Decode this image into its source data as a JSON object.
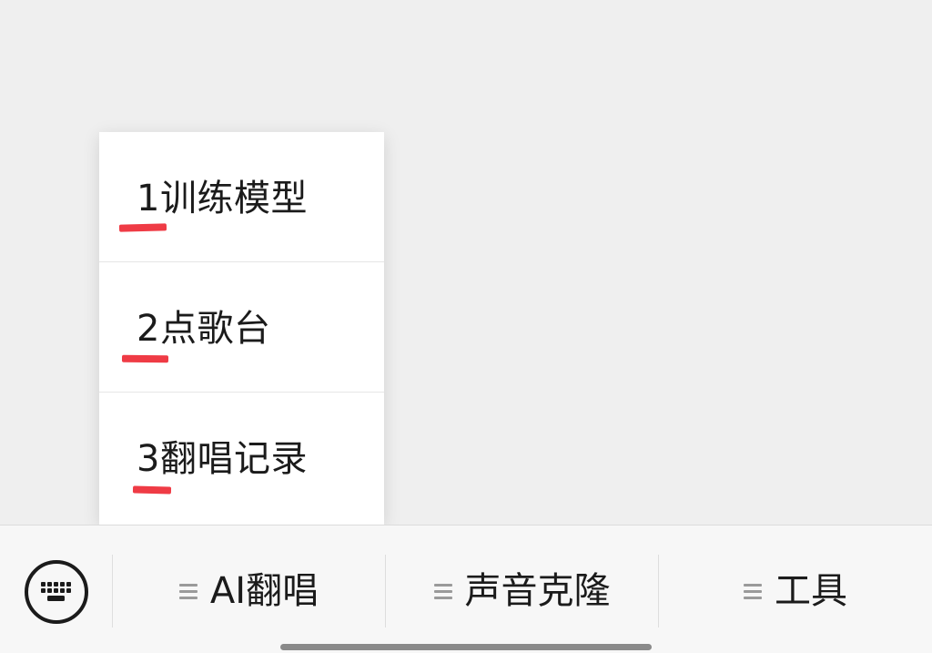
{
  "popup_menu": {
    "items": [
      {
        "label": "1训练模型"
      },
      {
        "label": "2点歌台"
      },
      {
        "label": "3翻唱记录"
      }
    ],
    "highlight_color": "#ef3b45"
  },
  "bottom_bar": {
    "keyboard_icon": "keyboard-icon",
    "menu_icon": "hamburger-menu-icon",
    "tabs": [
      {
        "label": "AI翻唱"
      },
      {
        "label": "声音克隆"
      },
      {
        "label": "工具"
      }
    ]
  }
}
